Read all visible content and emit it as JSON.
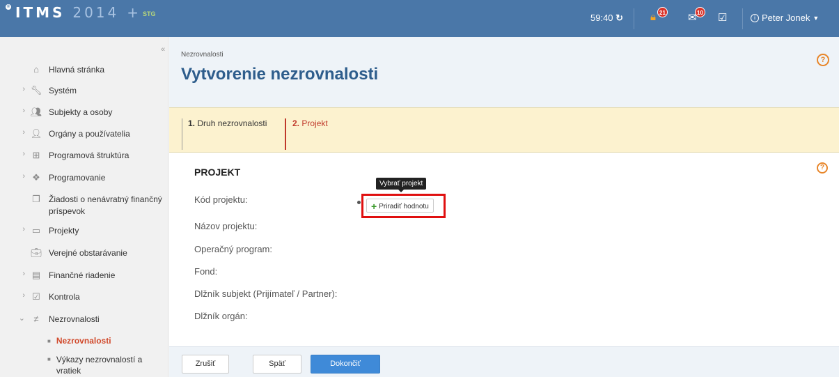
{
  "topbar": {
    "logo_main": "ITMS",
    "logo_year": "2014",
    "logo_plus": "+",
    "logo_suffix": "STG",
    "timer": "59:40",
    "lock_badge": "21",
    "mail_badge": "10",
    "user_name": "Peter Jonek"
  },
  "sidebar": {
    "collapse_label": "«",
    "items": [
      {
        "label": "Hlavná stránka",
        "icon": "home-icon",
        "has_arrow": false
      },
      {
        "label": "Systém",
        "icon": "wrench-icon",
        "has_arrow": true
      },
      {
        "label": "Subjekty a osoby",
        "icon": "people-icon",
        "has_arrow": true
      },
      {
        "label": "Orgány a používatelia",
        "icon": "user-list-icon",
        "has_arrow": true
      },
      {
        "label": "Programová štruktúra",
        "icon": "sitemap-icon",
        "has_arrow": true
      },
      {
        "label": "Programovanie",
        "icon": "cubes-icon",
        "has_arrow": true
      },
      {
        "label": "Žiadosti o nenávratný finančný príspevok",
        "icon": "documents-icon",
        "has_arrow": false
      },
      {
        "label": "Projekty",
        "icon": "inbox-icon",
        "has_arrow": true
      },
      {
        "label": "Verejné obstarávanie",
        "icon": "briefcase-icon",
        "has_arrow": false
      },
      {
        "label": "Finančné riadenie",
        "icon": "wallet-icon",
        "has_arrow": true
      },
      {
        "label": "Kontrola",
        "icon": "checklist-icon",
        "has_arrow": true
      },
      {
        "label": "Nezrovnalosti",
        "icon": "not-equal-icon",
        "has_arrow": true,
        "expanded": true
      }
    ],
    "sub_items": [
      {
        "label": "Nezrovnalosti",
        "active": true
      },
      {
        "label": "Výkazy nezrovnalostí a vratiek",
        "active": false
      }
    ]
  },
  "main": {
    "breadcrumb": "Nezrovnalosti",
    "title": "Vytvorenie nezrovnalosti",
    "steps": [
      {
        "num": "1.",
        "label": "Druh nezrovnalosti"
      },
      {
        "num": "2.",
        "label": "Projekt"
      }
    ],
    "section_title": "PROJEKT",
    "fields": [
      "Kód projektu:",
      "Názov projektu:",
      "Operačný program:",
      "Fond:",
      "Dlžník subjekt (Prijímateľ / Partner):",
      "Dlžník orgán:"
    ],
    "tooltip": "Vybrať projekt",
    "assign_button": "Priradiť hodnotu",
    "help": "?"
  },
  "footer": {
    "cancel": "Zrušiť",
    "back": "Späť",
    "finish": "Dokončiť"
  },
  "colors": {
    "topbar": "#4a77a8",
    "title": "#2e5d8c",
    "active_step": "#c0392b",
    "highlight": "#e01010",
    "primary_button": "#3f8ad8"
  }
}
